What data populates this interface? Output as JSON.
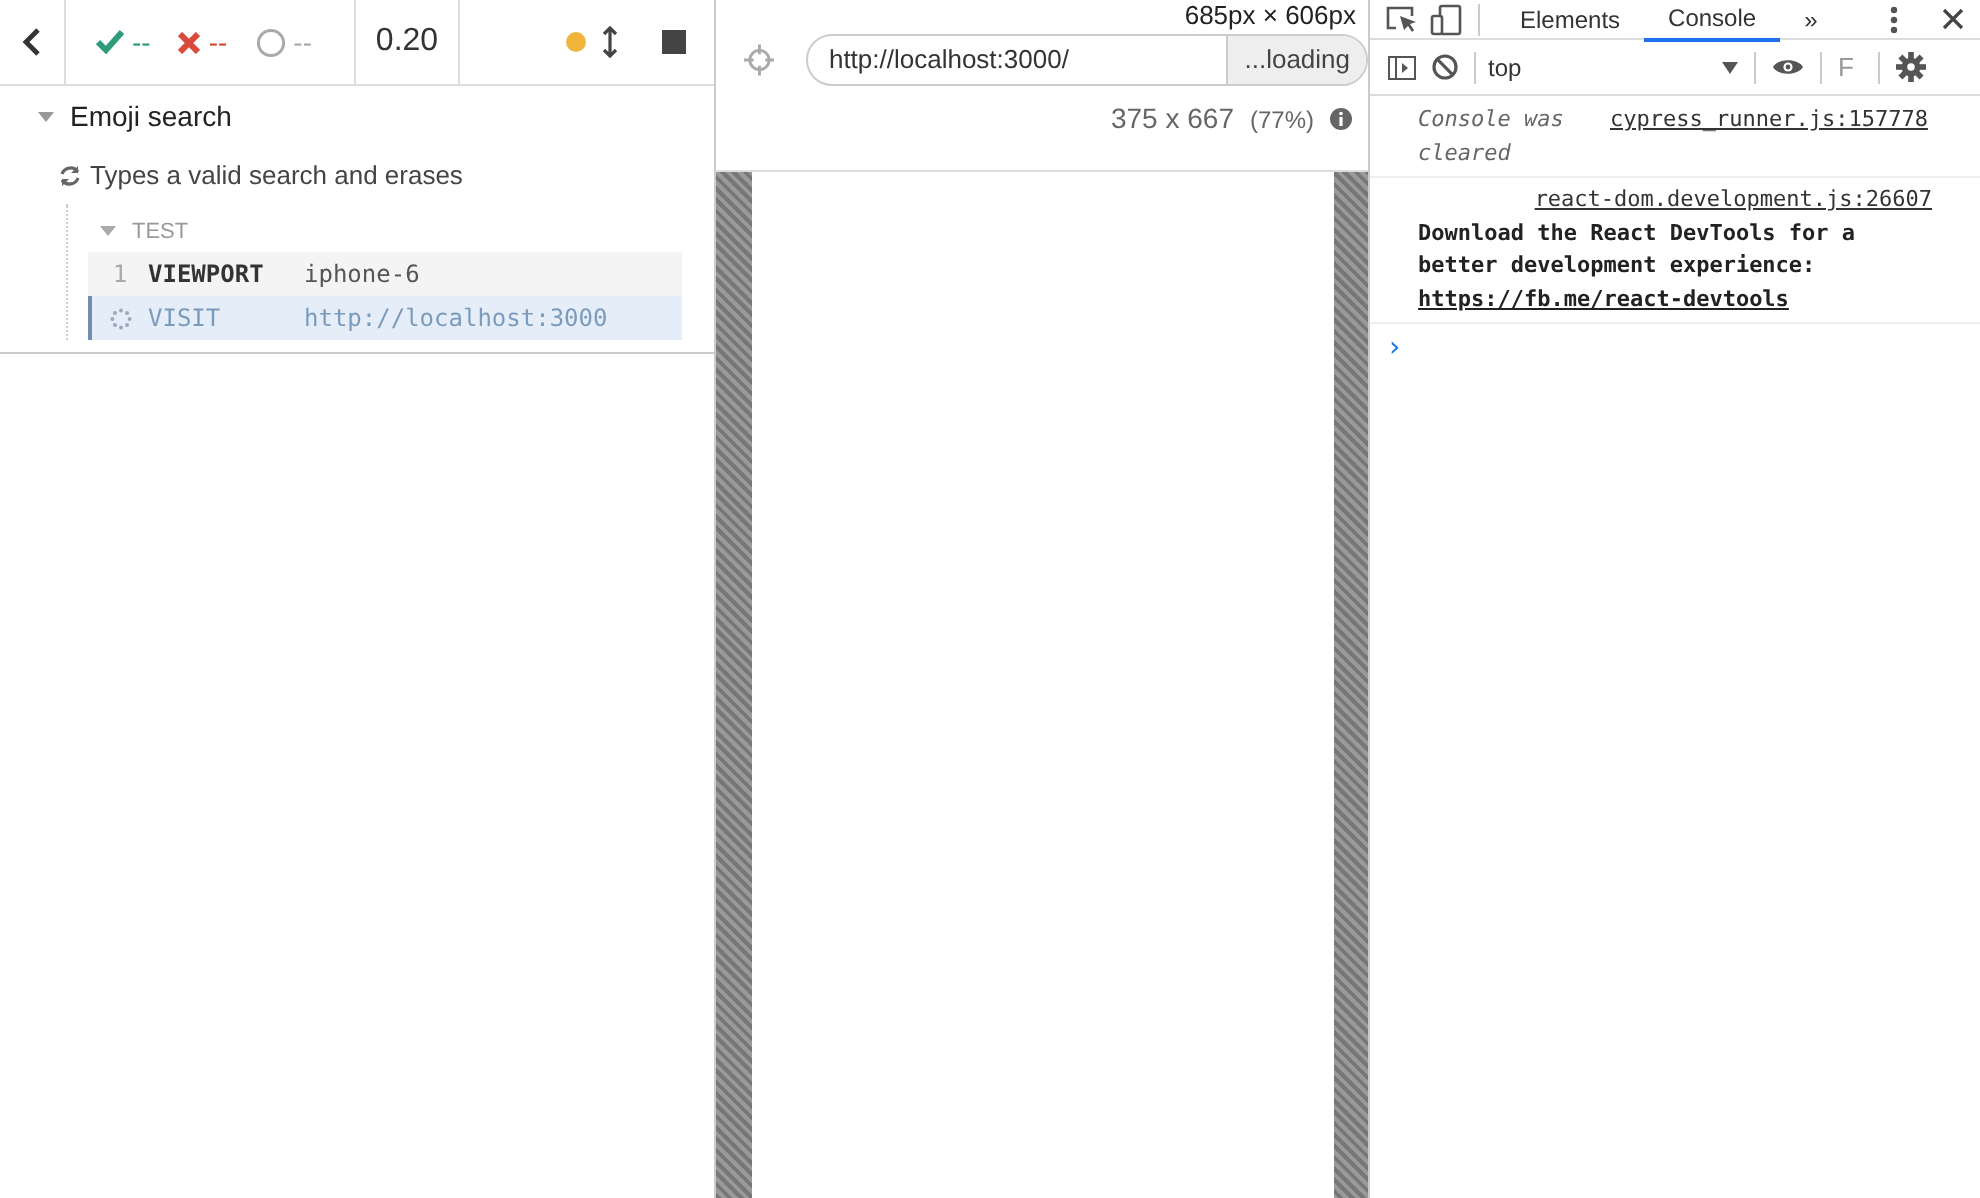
{
  "reporter": {
    "stats": [
      {
        "kind": "passed",
        "count": "--"
      },
      {
        "kind": "failed",
        "count": "--"
      },
      {
        "kind": "pending",
        "count": "--"
      }
    ],
    "duration": "0.20"
  },
  "suites": [
    {
      "title": "Emoji search",
      "expanded": true,
      "tests": [
        {
          "title": "Types a valid search and erases",
          "section": "TEST",
          "section_expanded": true,
          "commands": [
            {
              "kind": "done",
              "number": "1",
              "name": "VIEWPORT",
              "message": "iphone-6",
              "selected": false
            },
            {
              "kind": "pending",
              "name": "VISIT",
              "message": "http://localhost:3000",
              "selected": true
            }
          ]
        }
      ]
    }
  ],
  "aut": {
    "url": "http://localhost:3000/",
    "loading": "...loading",
    "viewport": "375 x 667",
    "scale": "(77%)",
    "size_overlay": "685px × 606px"
  },
  "devtools": {
    "tabs": [
      {
        "label": "Elements",
        "selected": false
      },
      {
        "label": "Console",
        "selected": true
      }
    ],
    "more": "»",
    "context": "top",
    "filter": "F",
    "messages": [
      {
        "kind": "info",
        "text": "Console was cleared",
        "source": "cypress_runner.js:157778"
      },
      {
        "kind": "log",
        "text": "Download the React DevTools for a better development experience: ",
        "link": "https://fb.me/react-devtools",
        "source": "react-dom.development.js:26607"
      }
    ],
    "prompt": "›"
  }
}
